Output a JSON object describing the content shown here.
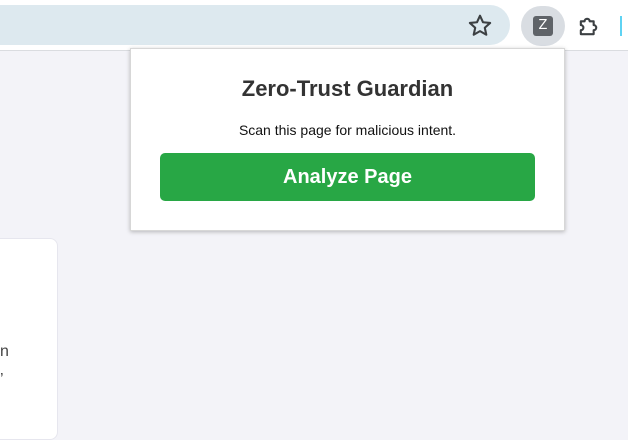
{
  "browser": {
    "extension_icon_letter": "Z",
    "star_icon": "star-outline-icon",
    "extensions_icon": "puzzle-piece-icon"
  },
  "popup": {
    "title": "Zero-Trust Guardian",
    "subtitle": "Scan this page for malicious intent.",
    "analyze_label": "Analyze Page",
    "accent_color": "#28a745"
  },
  "page": {
    "fragment_1": "n",
    "fragment_2": "’"
  }
}
